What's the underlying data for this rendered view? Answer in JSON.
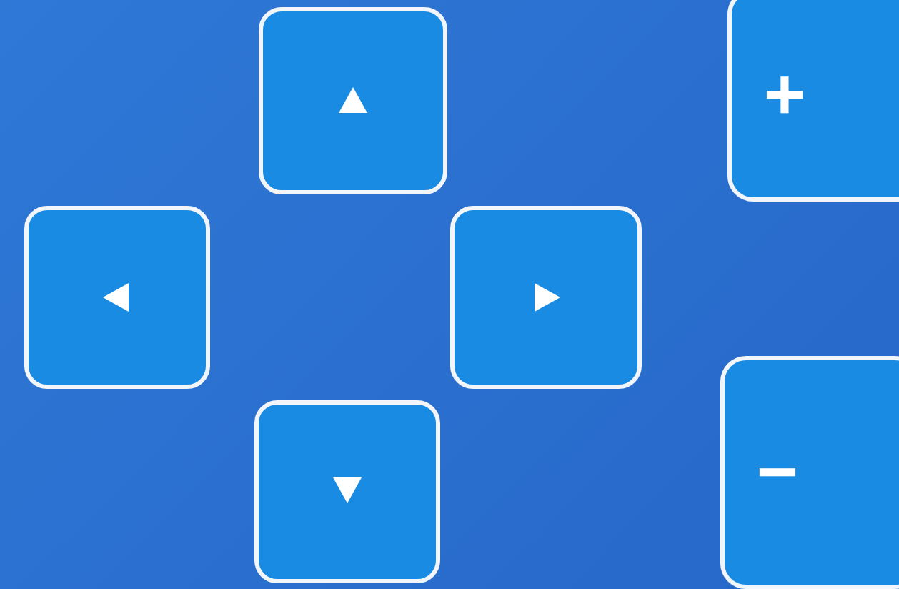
{
  "dpad": [
    {
      "kind": "up"
    },
    {
      "kind": "left"
    },
    {
      "kind": "right"
    },
    {
      "kind": "down"
    }
  ],
  "zoom": [
    {
      "label": "+"
    },
    {
      "label": "−"
    }
  ]
}
